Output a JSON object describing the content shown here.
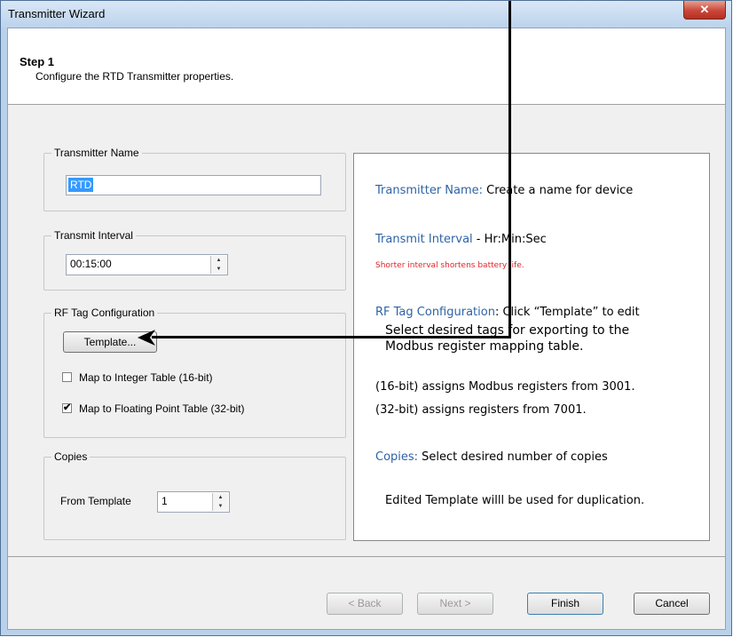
{
  "window": {
    "title": "Transmitter Wizard",
    "close_glyph": "✕"
  },
  "header": {
    "step_title": "Step 1",
    "step_desc": "Configure the RTD Transmitter properties."
  },
  "transmitter_name": {
    "label": "Transmitter Name",
    "value": "RTD"
  },
  "transmit_interval": {
    "label": "Transmit Interval",
    "value": "00:15:00"
  },
  "rf_tag": {
    "label": "RF Tag Configuration",
    "template_button": "Template...",
    "map_integer": {
      "label": "Map to Integer Table (16-bit)",
      "checked": false
    },
    "map_float": {
      "label": "Map to Floating Point Table (32-bit)",
      "checked": true,
      "check_glyph": "✔"
    }
  },
  "copies": {
    "label": "Copies",
    "from_template_label": "From Template",
    "value": "1"
  },
  "help": {
    "name_key": "Transmitter Name:",
    "name_text": " Create a name for device",
    "interval_key": "Transmit Interval",
    "interval_text": " - Hr:Min:Sec",
    "interval_warning": "Shorter interval shortens battery life.",
    "rf_key": "RF Tag Configuration",
    "rf_text": ": Click “Template” to edit",
    "rf_line2": "Select desired tags for exporting to the",
    "rf_line3": "Modbus register mapping table.",
    "rf_line4": "(16-bit) assigns Modbus registers from 3001.",
    "rf_line5": "(32-bit) assigns registers from 7001.",
    "copies_key": "Copies:",
    "copies_text": " Select desired number of copies",
    "copies_line2": "Edited Template willl be used for duplication."
  },
  "footer": {
    "back": "< Back",
    "next": "Next >",
    "finish": "Finish",
    "cancel": "Cancel"
  },
  "colors": {
    "help_key": "#2f63a5",
    "warning": "#e0252a",
    "selection": "#3399ff"
  },
  "icons": {
    "spin_up": "▲",
    "spin_down": "▼"
  }
}
